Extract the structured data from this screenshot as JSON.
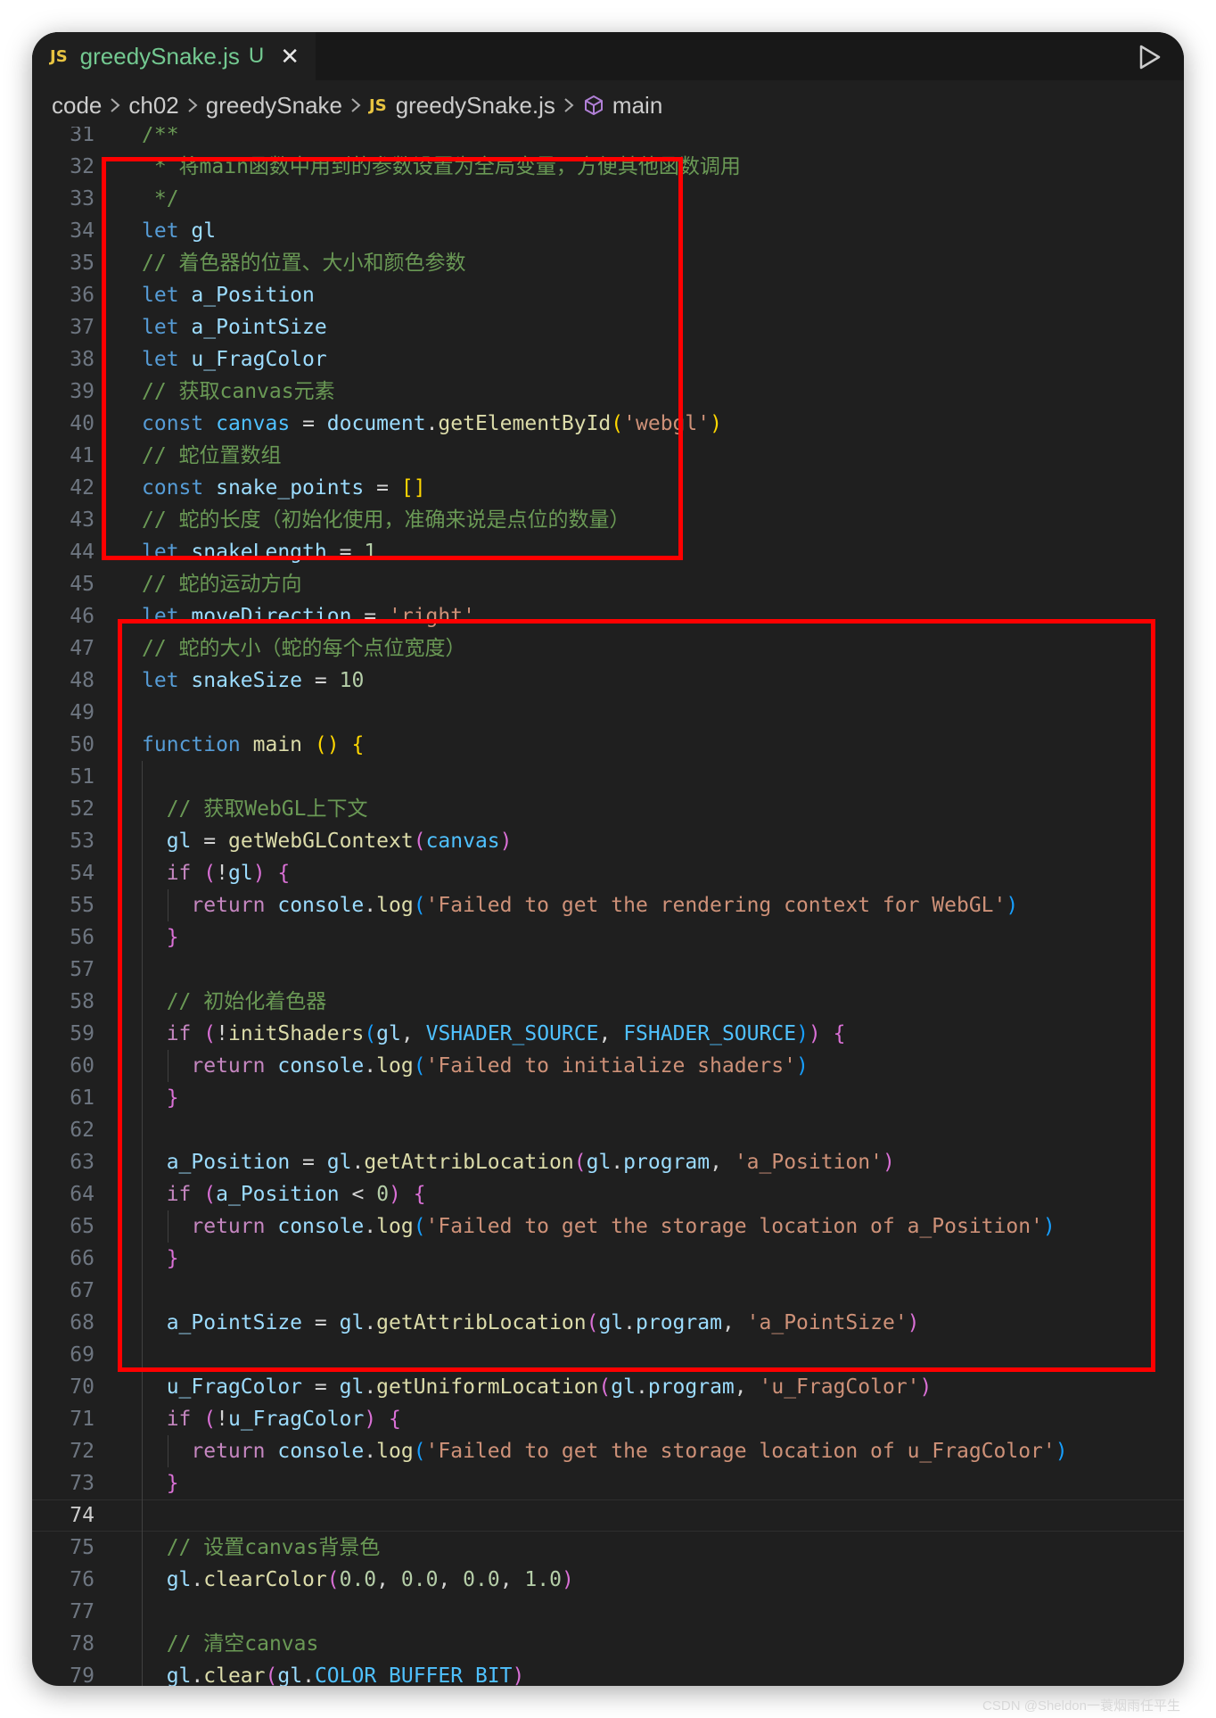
{
  "tab": {
    "icon": "JS",
    "filename": "greedySnake.js",
    "status": "U",
    "close": "✕"
  },
  "breadcrumb": {
    "items": [
      "code",
      "ch02",
      "greedySnake"
    ],
    "file_icon": "JS",
    "file": "greedySnake.js",
    "symbol": "main"
  },
  "watermark": "CSDN @Sheldon一蓑烟雨任平生",
  "colors": {
    "editor_bg": "#1f1f1f",
    "highlight_box": "#ff0000"
  },
  "lines": [
    {
      "n": "31",
      "c": "kw",
      "t": "/**"
    },
    {
      "n": "32",
      "c": "cmt",
      "t": " * 将main函数中用到的参数设置为全局变量，方便其他函数调用"
    },
    {
      "n": "33",
      "c": "cmt",
      "t": " */"
    },
    {
      "n": "34",
      "t": "let gl"
    },
    {
      "n": "35",
      "t": "// 着色器的位置、大小和颜色参数"
    },
    {
      "n": "36",
      "t": "let a_Position"
    },
    {
      "n": "37",
      "t": "let a_PointSize"
    },
    {
      "n": "38",
      "t": "let u_FragColor"
    },
    {
      "n": "39",
      "t": "// 获取canvas元素"
    },
    {
      "n": "40",
      "t": "const canvas = document.getElementById('webgl')"
    },
    {
      "n": "41",
      "t": "// 蛇位置数组"
    },
    {
      "n": "42",
      "t": "const snake_points = []"
    },
    {
      "n": "43",
      "t": "// 蛇的长度（初始化使用，准确来说是点位的数量）"
    },
    {
      "n": "44",
      "t": "let snakeLength = 1"
    },
    {
      "n": "45",
      "t": "// 蛇的运动方向"
    },
    {
      "n": "46",
      "t": "let moveDirection = 'right'"
    },
    {
      "n": "47",
      "t": "// 蛇的大小（蛇的每个点位宽度）"
    },
    {
      "n": "48",
      "t": "let snakeSize = 10"
    },
    {
      "n": "49",
      "t": ""
    },
    {
      "n": "50",
      "t": "function main () {"
    },
    {
      "n": "51",
      "t": ""
    },
    {
      "n": "52",
      "t": "  // 获取WebGL上下文"
    },
    {
      "n": "53",
      "t": "  gl = getWebGLContext(canvas)"
    },
    {
      "n": "54",
      "t": "  if (!gl) {"
    },
    {
      "n": "55",
      "t": "    return console.log('Failed to get the rendering context for WebGL')"
    },
    {
      "n": "56",
      "t": "  }"
    },
    {
      "n": "57",
      "t": ""
    },
    {
      "n": "58",
      "t": "  // 初始化着色器"
    },
    {
      "n": "59",
      "t": "  if (!initShaders(gl, VSHADER_SOURCE, FSHADER_SOURCE)) {"
    },
    {
      "n": "60",
      "t": "    return console.log('Failed to initialize shaders')"
    },
    {
      "n": "61",
      "t": "  }"
    },
    {
      "n": "62",
      "t": ""
    },
    {
      "n": "63",
      "t": "  a_Position = gl.getAttribLocation(gl.program, 'a_Position')"
    },
    {
      "n": "64",
      "t": "  if (a_Position < 0) {"
    },
    {
      "n": "65",
      "t": "    return console.log('Failed to get the storage location of a_Position')"
    },
    {
      "n": "66",
      "t": "  }"
    },
    {
      "n": "67",
      "t": ""
    },
    {
      "n": "68",
      "t": "  a_PointSize = gl.getAttribLocation(gl.program, 'a_PointSize')"
    },
    {
      "n": "69",
      "t": ""
    },
    {
      "n": "70",
      "t": "  u_FragColor = gl.getUniformLocation(gl.program, 'u_FragColor')"
    },
    {
      "n": "71",
      "t": "  if (!u_FragColor) {"
    },
    {
      "n": "72",
      "t": "    return console.log('Failed to get the storage location of u_FragColor')"
    },
    {
      "n": "73",
      "t": "  }"
    },
    {
      "n": "74",
      "t": ""
    },
    {
      "n": "75",
      "t": "  // 设置canvas背景色"
    },
    {
      "n": "76",
      "t": "  gl.clearColor(0.0, 0.0, 0.0, 1.0)"
    },
    {
      "n": "77",
      "t": ""
    },
    {
      "n": "78",
      "t": "  // 清空canvas"
    },
    {
      "n": "79",
      "t": "  gl.clear(gl.COLOR_BUFFER_BIT)"
    }
  ]
}
